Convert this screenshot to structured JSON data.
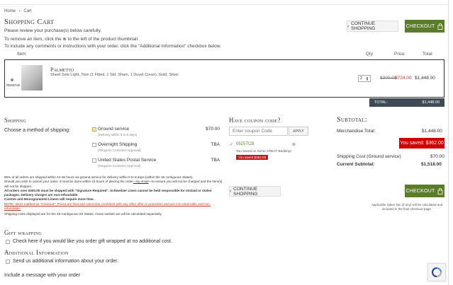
{
  "breadcrumb": {
    "home": "Home",
    "sep": "›",
    "current": "Cart"
  },
  "cart": {
    "title": "Shopping Cart",
    "intro": [
      "Please review your purchase(s) below carefully.",
      "To remove an item, click the ⊗ to the left of the product thumbnail.",
      "To include any comments or instructions with your order, click the \"Additional Information\" checkbox below."
    ],
    "continue_label": "CONTINUE SHOPPING",
    "checkout_label": "CHECKOUT",
    "columns": {
      "item": "Item",
      "qty": "Qty",
      "price": "Price",
      "total": "Total"
    },
    "item": {
      "remove_label": "REMOVE",
      "name": "Palmetto",
      "description": "Sheet Sets Light, Twin (1 Fitted, 1 Std. Sham, 1 Duvet Cover), Gold, Silver",
      "qty": "2",
      "old_price": "$300.00",
      "new_price": "$724.00",
      "total": "$1,448.00"
    },
    "total_bar": {
      "label": "TOTAL:",
      "value": "$1,448.00"
    }
  },
  "shipping": {
    "title": "Shipping",
    "choose_label": "Choose a method of shipping:",
    "options": [
      {
        "name": "Ground service",
        "note": "(Delivery within 6 to 8 days)",
        "price": "$70.00",
        "selected": true
      },
      {
        "name": "Overnight Shipping",
        "note": "(Requires Customer Approval)",
        "price": "TBA",
        "selected": false
      },
      {
        "name": "United States Postal Service",
        "note": "(Requires Customer Approval)",
        "price": "TBA",
        "selected": false
      }
    ],
    "notes": {
      "p1": "95% of all orders are shipped within 24-48 hours via ground service for delivery within 6 to 8 days (within the 48 contiguous States).",
      "p2a": "Should you wish to cancel your order, it must be done within 24 hours of placing the order",
      "p2b": "—by email",
      "p2c": "—to ensure you will not be charged and the item(s) will not be shipped.",
      "p3": "All orders over $300.00 must be shipped with \"Signature Required\". Schweitzer Linen cannot be held responsible for mislaid or stolen packages. Delivery charges are non-refundable.",
      "p4": "Custom and Monogrammed Linens will require more time.",
      "p5": "NOTE: Items marked as \"Closeout\": Prices are final and cannot be combined with any other offer or promotion and are non-returnable and non-refundable.",
      "p6": "Shipping costs displayed are for the 48 Contiguous US States. Areas outside we will be calculated separately."
    }
  },
  "gift": {
    "title": "Gift wrapping",
    "checkbox_label": "Check here if you would like you order gift wrapped at no additional cost."
  },
  "additional": {
    "title": "Additional Information",
    "checkbox_label": "Send us additional information about your order.",
    "message_label": "Include a message with your order"
  },
  "coupon": {
    "title": "Have coupon code?",
    "placeholder": "Enter coupon Code",
    "apply_label": "APPLY",
    "applied_code": "0525TCB",
    "applied_desc": "You Saved on Some GREAT Bedding!",
    "applied_saved": "You saved $362.00",
    "continue_label": "CONTINUE SHOPPING"
  },
  "subtotal": {
    "title": "Subtotal:",
    "merch_label": "Merchandise Total:",
    "merch_value": "$1,448.00",
    "saved_label": "You saved: $362.00",
    "shipping_label": "Shipping Cost (Ground service)",
    "shipping_value": "$70.00",
    "current_label": "Current Subtotal:",
    "current_value": "$1,518.00",
    "checkout_label": "CHECKOUT",
    "tax_note": "Applicable Sales Tax (if any) will be calculated and included in the final checkout page."
  },
  "colors": {
    "checkout_green": "#5b7d2a",
    "saved_red": "#d10000",
    "total_bar": "#3e4a54"
  }
}
